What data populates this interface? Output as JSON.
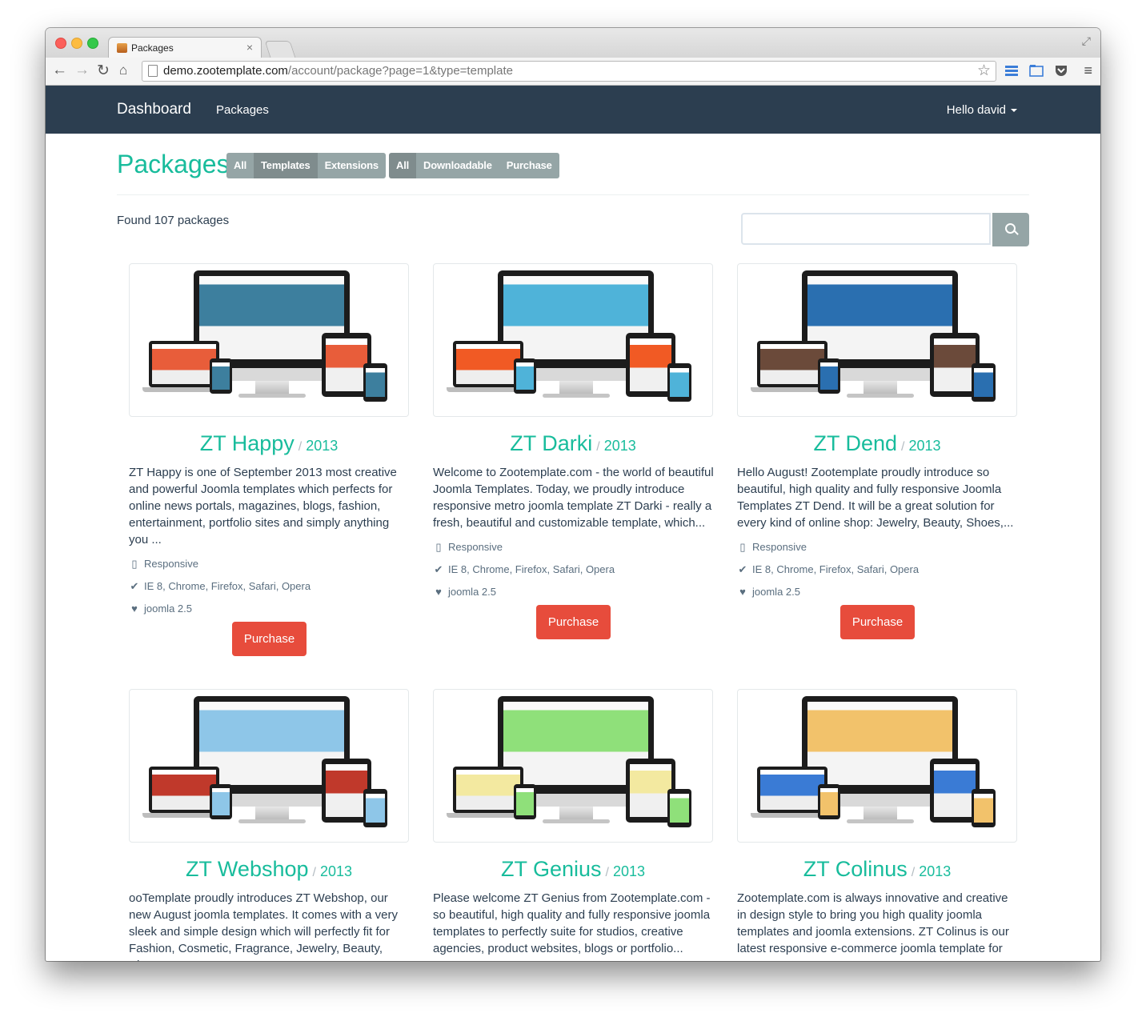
{
  "browser": {
    "tab_title": "Packages",
    "url_host": "demo.zootemplate.com",
    "url_path": "/account/package?page=1&type=template"
  },
  "navbar": {
    "brand": "Dashboard",
    "link_packages": "Packages",
    "user": "Hello david"
  },
  "page": {
    "title": "Packages",
    "type_filters": [
      "All",
      "Templates",
      "Extensions"
    ],
    "type_active": "Templates",
    "purchase_filters": [
      "All",
      "Downloadable",
      "Purchase"
    ],
    "purchase_active": "All",
    "found_text": "Found 107 packages",
    "search_placeholder": ""
  },
  "colors": {
    "accent": "#18bc9c",
    "navbar": "#2c3e50",
    "purchase": "#e74c3c",
    "filter": "#95a5a6"
  },
  "packages": [
    {
      "name": "ZT Happy",
      "year": "2013",
      "desc": "ZT Happy is one of September 2013 most creative and powerful Joomla templates which perfects for online news portals, magazines, blogs, fashion, entertainment, portfolio sites and simply anything you ...",
      "responsive": "Responsive",
      "browsers": "IE 8, Chrome, Firefox, Safari, Opera",
      "joomla": "joomla 2.5",
      "button": "Purchase",
      "screen": "#3d7f9e",
      "screen2": "#e85d3a"
    },
    {
      "name": "ZT Darki",
      "year": "2013",
      "desc": "Welcome to Zootemplate.com - the world of beautiful Joomla Templates. Today, we proudly introduce responsive metro joomla template ZT Darki - really a fresh, beautiful and customizable template, which...",
      "responsive": "Responsive",
      "browsers": "IE 8, Chrome, Firefox, Safari, Opera",
      "joomla": "joomla 2.5",
      "button": "Purchase",
      "screen": "#4fb3d9",
      "screen2": "#f15a24"
    },
    {
      "name": "ZT Dend",
      "year": "2013",
      "desc": "Hello August! Zootemplate proudly introduce so beautiful, high quality and fully responsive Joomla Templates ZT Dend. It will be a great solution for every kind of online shop: Jewelry, Beauty, Shoes,...",
      "responsive": "Responsive",
      "browsers": "IE 8, Chrome, Firefox, Safari, Opera",
      "joomla": "joomla 2.5",
      "button": "Purchase",
      "screen": "#2a6fb0",
      "screen2": "#6b4a3a"
    },
    {
      "name": "ZT Webshop",
      "year": "2013",
      "desc": "ooTemplate proudly introduces ZT Webshop, our new August joomla templates. It comes with a very sleek and simple design which will perfectly fit for Fashion, Cosmetic, Fragrance, Jewelry, Beauty, Shoe...",
      "screen": "#8ec6e8",
      "screen2": "#c0392b"
    },
    {
      "name": "ZT Genius",
      "year": "2013",
      "desc": "Please welcome ZT Genius from Zootemplate.com - so beautiful, high quality and fully responsive joomla templates to perfectly suite for studios, creative agencies, product websites, blogs or portfolio...",
      "screen": "#8fe07a",
      "screen2": "#f3e9a0"
    },
    {
      "name": "ZT Colinus",
      "year": "2013",
      "desc": "Zootemplate.com is always innovative and creative in design style to bring you high quality joomla templates and joomla extensions. ZT Colinus is our latest responsive e-commerce joomla template for e...",
      "screen": "#f2c26b",
      "screen2": "#3a7bd5"
    }
  ]
}
